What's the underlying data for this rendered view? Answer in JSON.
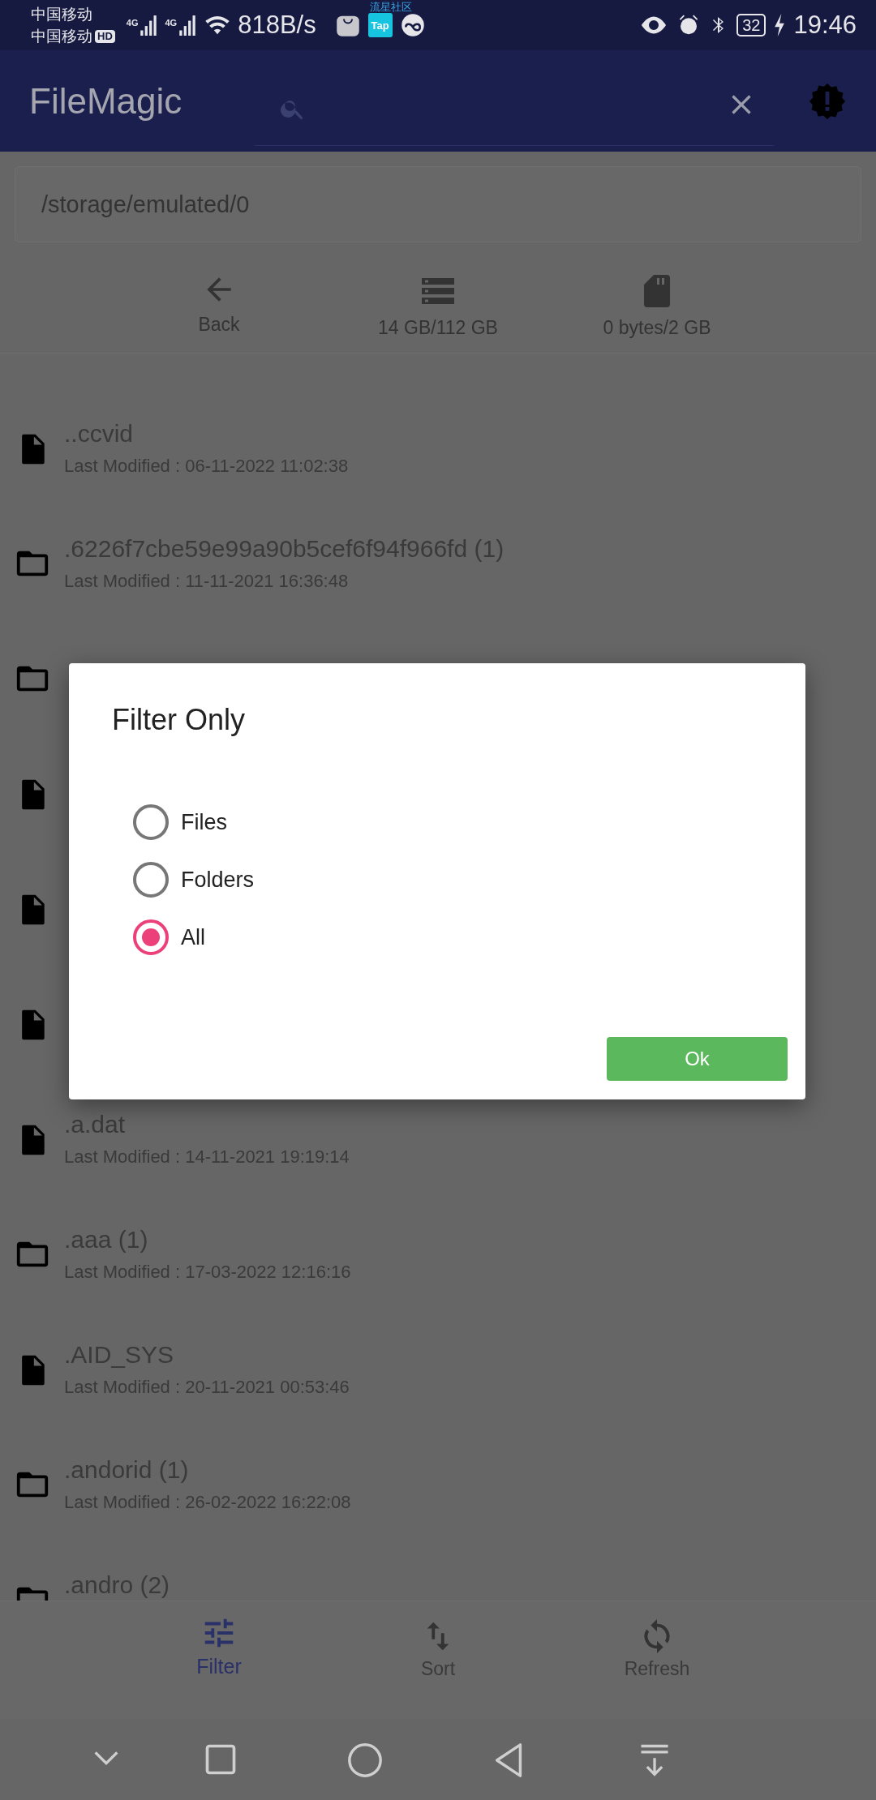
{
  "status_bar": {
    "carrier_1": "中国移动",
    "carrier_2": "中国移动",
    "hd_badge": "HD",
    "network_1": "4G",
    "network_2": "4G",
    "speed": "818B/s",
    "app_badge": "Tap",
    "notification_label": "流星社区",
    "battery": "32",
    "time": "19:46"
  },
  "app_bar": {
    "title": "FileMagic"
  },
  "path": "/storage/emulated/0",
  "toolbar": [
    {
      "kind": "back",
      "label": "Back"
    },
    {
      "kind": "internal",
      "label": "14 GB/112 GB"
    },
    {
      "kind": "sd",
      "label": "0 bytes/2 GB"
    }
  ],
  "files": [
    {
      "kind": "file",
      "name": "..ccvid",
      "modified": "Last Modified : 06-11-2022 11:02:38"
    },
    {
      "kind": "folder",
      "name": ".6226f7cbe59e99a90b5cef6f94f966fd (1)",
      "modified": "Last Modified : 11-11-2021 16:36:48"
    },
    {
      "kind": "folder"
    },
    {
      "kind": "file"
    },
    {
      "kind": "file"
    },
    {
      "kind": "file"
    },
    {
      "kind": "file",
      "name": ".a.dat",
      "modified": "Last Modified : 14-11-2021 19:19:14"
    },
    {
      "kind": "folder",
      "name": ".aaa (1)",
      "modified": "Last Modified : 17-03-2022 12:16:16"
    },
    {
      "kind": "file",
      "name": ".AID_SYS",
      "modified": "Last Modified : 20-11-2021 00:53:46"
    },
    {
      "kind": "folder",
      "name": ".andorid (1)",
      "modified": "Last Modified : 26-02-2022 16:22:08"
    },
    {
      "kind": "folder",
      "name": ".andro (2)"
    }
  ],
  "dialog": {
    "title": "Filter Only",
    "options": [
      {
        "label": "Files",
        "selected": false
      },
      {
        "label": "Folders",
        "selected": false
      },
      {
        "label": "All",
        "selected": true
      }
    ],
    "button": "Ok"
  },
  "bottom_nav": [
    {
      "kind": "filter",
      "label": "Filter",
      "selected": true
    },
    {
      "kind": "sort",
      "label": "Sort",
      "selected": false
    },
    {
      "kind": "refresh",
      "label": "Refresh",
      "selected": false
    }
  ]
}
